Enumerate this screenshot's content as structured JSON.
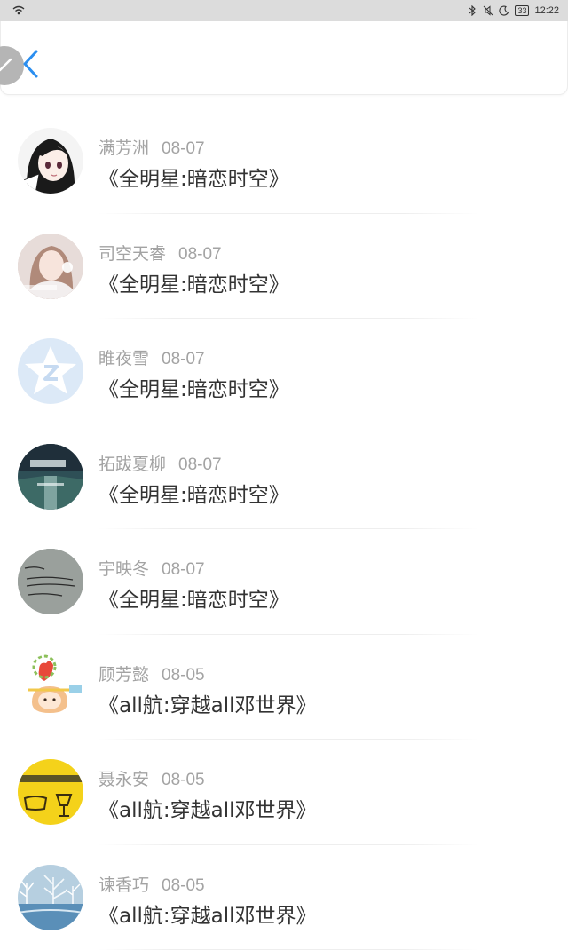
{
  "status_bar": {
    "battery": "33",
    "time": "12:22"
  },
  "list": [
    {
      "name": "满芳洲",
      "date": "08-07",
      "title": "《全明星:暗恋时空》",
      "avatar_icon": "anime-girl-avatar-icon"
    },
    {
      "name": "司空天睿",
      "date": "08-07",
      "title": "《全明星:暗恋时空》",
      "avatar_icon": "photo-girl-avatar-icon"
    },
    {
      "name": "睢夜雪",
      "date": "08-07",
      "title": "《全明星:暗恋时空》",
      "avatar_icon": "default-star-avatar-icon"
    },
    {
      "name": "拓跋夏柳",
      "date": "08-07",
      "title": "《全明星:暗恋时空》",
      "avatar_icon": "street-photo-avatar-icon"
    },
    {
      "name": "宇映冬",
      "date": "08-07",
      "title": "《全明星:暗恋时空》",
      "avatar_icon": "handwriting-avatar-icon"
    },
    {
      "name": "顾芳懿",
      "date": "08-05",
      "title": "《all航:穿越all邓世界》",
      "avatar_icon": "cartoon-heart-avatar-icon"
    },
    {
      "name": "聂永安",
      "date": "08-05",
      "title": "《all航:穿越all邓世界》",
      "avatar_icon": "yellow-sign-avatar-icon"
    },
    {
      "name": "谏香巧",
      "date": "08-05",
      "title": "《all航:穿越all邓世界》",
      "avatar_icon": "winter-tree-avatar-icon"
    }
  ],
  "colors": {
    "accent": "#2a8ef0",
    "name_text": "#a3a3a3",
    "title_text": "#333333",
    "status_bar_bg": "#dcdcdc"
  }
}
